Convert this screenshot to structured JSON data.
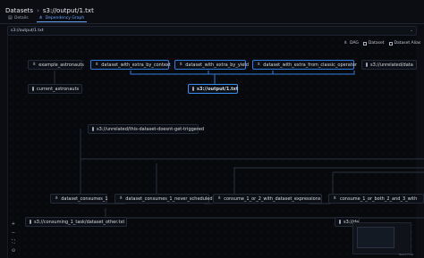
{
  "breadcrumb": {
    "root": "Datasets",
    "current": "s3://output/1.txt"
  },
  "tabs": [
    {
      "label": "Details",
      "active": false
    },
    {
      "label": "Dependency Graph",
      "active": true
    }
  ],
  "dataset_select": {
    "value": "s3://output/1.txt"
  },
  "legend": {
    "dag": "DAG",
    "dataset": "Dataset",
    "alias": "Dataset Alias"
  },
  "nodes": {
    "example_astronauts": "example_astronauts",
    "current_astronauts": "current_astronauts",
    "extra_by_context": "dataset_with_extra_by_context",
    "extra_by_yield": "dataset_with_extra_by_yield",
    "extra_classic": "dataset_with_extra_from_classic_operator",
    "unrelated_trunc": "s3://unrelated/data",
    "output": "s3://output/1.txt",
    "unrelated_never": "s3://unrelated/this-dataset-doesnt-get-triggered",
    "consumes_1": "dataset_consumes_1",
    "never_scheduled": "dataset_consumes_1_never_scheduled",
    "consume_expr": "consume_1_or_2_with_dataset_expressions",
    "consume_both": "consume_1_or_both_2_and_3_with",
    "consuming_task": "s3://consuming_1_task/dataset_other.txt",
    "right_dataset": "s3://da"
  },
  "controls": [
    "+",
    "−",
    "⛶",
    "⊙"
  ],
  "attribution": "React Flow"
}
